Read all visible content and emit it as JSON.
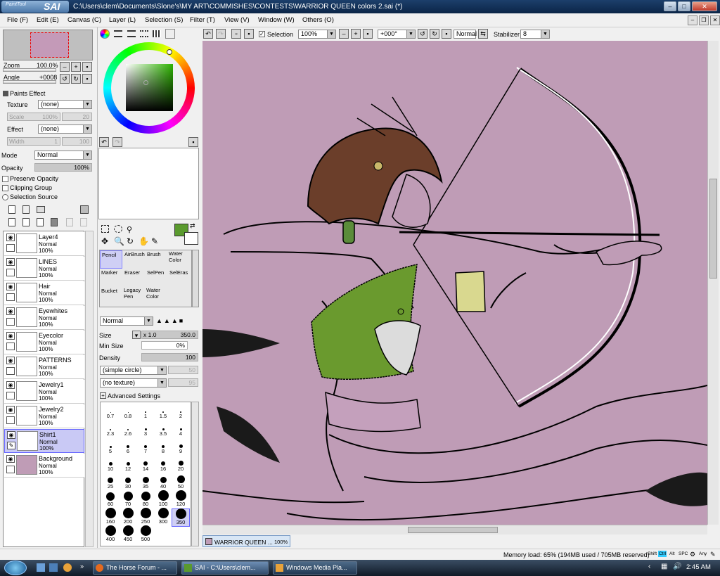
{
  "window": {
    "app_logo_small": "PaintTool",
    "app_logo": "SAI",
    "title": "C:\\Users\\clem\\Documents\\Slone's\\MY ART\\COMMISHES\\CONTESTS\\WARRIOR QUEEN colors 2.sai (*)"
  },
  "menu": [
    "File (F)",
    "Edit (E)",
    "Canvas (C)",
    "Layer (L)",
    "Selection (S)",
    "Filter (T)",
    "View (V)",
    "Window (W)",
    "Others (O)"
  ],
  "navigator": {
    "zoom_label": "Zoom",
    "zoom_value": "100.0%",
    "angle_label": "Angle",
    "angle_value": "+0008"
  },
  "paints_effect": {
    "header": "Paints Effect",
    "texture_label": "Texture",
    "texture_value": "(none)",
    "scale_label": "Scale",
    "scale_value": "100%",
    "scale_num": "20",
    "effect_label": "Effect",
    "effect_value": "(none)",
    "width_label": "Width",
    "width_value": "1",
    "width_num": "100"
  },
  "layer_props": {
    "mode_label": "Mode",
    "mode_value": "Normal",
    "opacity_label": "Opacity",
    "opacity_value": "100%",
    "preserve_opacity": "Preserve Opacity",
    "clipping_group": "Clipping Group",
    "selection_source": "Selection Source"
  },
  "layers": [
    {
      "name": "Layer4",
      "mode": "Normal",
      "opacity": "100%"
    },
    {
      "name": "LINES",
      "mode": "Normal",
      "opacity": "100%"
    },
    {
      "name": "Hair",
      "mode": "Normal",
      "opacity": "100%"
    },
    {
      "name": "Eyewhites",
      "mode": "Normal",
      "opacity": "100%"
    },
    {
      "name": "Eyecolor",
      "mode": "Normal",
      "opacity": "100%"
    },
    {
      "name": "PATTERNS",
      "mode": "Normal",
      "opacity": "100%"
    },
    {
      "name": "Jewelry1",
      "mode": "Normal",
      "opacity": "100%"
    },
    {
      "name": "Jewelry2",
      "mode": "Normal",
      "opacity": "100%"
    },
    {
      "name": "Shirt1",
      "mode": "Normal",
      "opacity": "100%"
    },
    {
      "name": "Background",
      "mode": "Normal",
      "opacity": "100%"
    }
  ],
  "tools": {
    "row1": [
      "Pencil",
      "AirBrush",
      "Brush",
      "Water Color"
    ],
    "row2": [
      "Marker",
      "Eraser",
      "SelPen",
      "SelEras"
    ],
    "row3": [
      "Bucket",
      "Legacy Pen",
      "Water Color"
    ]
  },
  "brush": {
    "blend_mode": "Normal",
    "size_label": "Size",
    "size_mult": "x 1.0",
    "size_value": "350.0",
    "min_size_label": "Min Size",
    "min_size_value": "0%",
    "density_label": "Density",
    "density_value": "100",
    "shape": "(simple circle)",
    "shape_num": "50",
    "texture": "(no texture)",
    "texture_num": "95",
    "advanced": "Advanced Settings"
  },
  "brush_sizes": [
    "0.7",
    "0.8",
    "1",
    "1.5",
    "2",
    "2.3",
    "2.6",
    "3",
    "3.5",
    "4",
    "5",
    "6",
    "7",
    "8",
    "9",
    "10",
    "12",
    "14",
    "16",
    "20",
    "25",
    "30",
    "35",
    "40",
    "50",
    "60",
    "70",
    "80",
    "100",
    "120",
    "160",
    "200",
    "250",
    "300",
    "350",
    "400",
    "450",
    "500"
  ],
  "canvas_toolbar": {
    "selection_label": "Selection",
    "zoom": "100%",
    "angle": "+000°",
    "blend": "Normal",
    "stabilizer_label": "Stabilizer",
    "stabilizer_value": "8"
  },
  "document_tab": {
    "name": "WARRIOR QUEEN ...",
    "zoom": "100%"
  },
  "status": {
    "memory": "Memory load: 65% (194MB used / 705MB reserved)",
    "keys": [
      "Shift",
      "Ctrl",
      "Alt",
      "SPC",
      "Any"
    ]
  },
  "taskbar": {
    "items": [
      "The Horse Forum - ...",
      "SAI - C:\\Users\\clem...",
      "Windows Media Pla..."
    ],
    "clock": "2:45 AM"
  },
  "colors": {
    "title_bg": "#0b2547",
    "canvas_bg": "#bf9cb6",
    "shirt": "#6a9a2e",
    "primary_color": "#5a9a2e",
    "selected_layer": "#c9c9f5",
    "taskbar": "#1a2838"
  }
}
